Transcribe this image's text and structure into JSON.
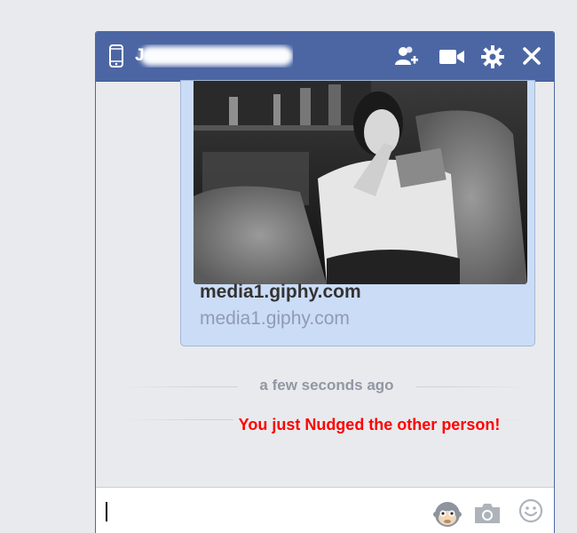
{
  "chat": {
    "contact_name": "J",
    "attachment": {
      "title": "media1.giphy.com",
      "domain": "media1.giphy.com"
    },
    "timestamp": "a few seconds ago",
    "notice": "You just Nudged the other person!"
  },
  "icons": {
    "mobile": "phone-icon",
    "add": "add-friend-icon",
    "video": "video-camera-icon",
    "settings": "gear-icon",
    "close": "close-icon",
    "sticker": "sticker-icon",
    "photo": "camera-icon",
    "emoji": "emoji-icon"
  },
  "colors": {
    "header": "#4c66a4",
    "bubble": "#cbdcf7",
    "notice": "#ff0000",
    "timestamp": "#9197a3"
  },
  "composer": {
    "value": "",
    "placeholder": ""
  }
}
